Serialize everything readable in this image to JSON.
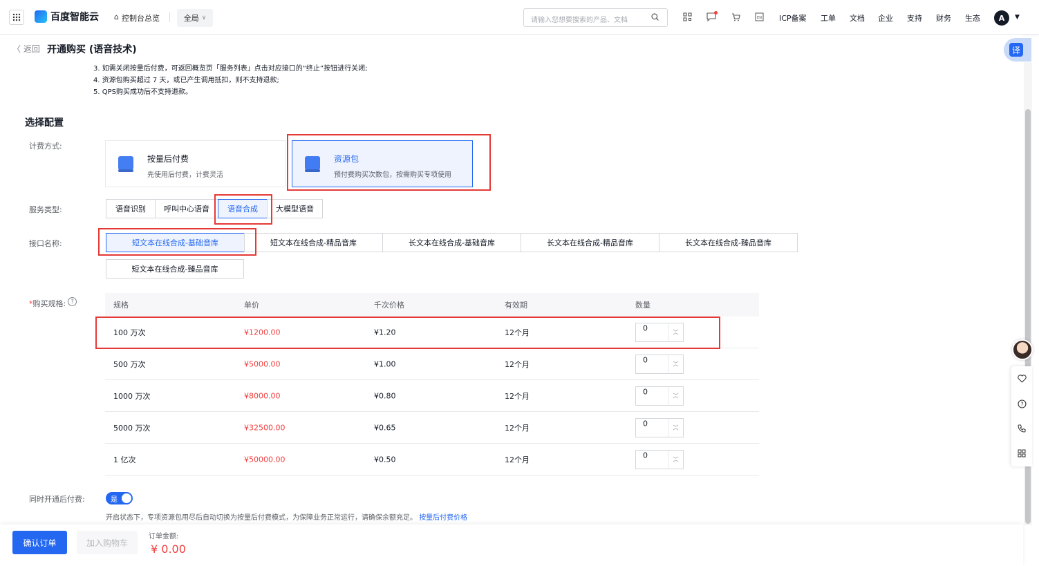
{
  "topbar": {
    "brand": "百度智能云",
    "console": "控制台总览",
    "region": "全局",
    "search_placeholder": "请输入您想要搜索的产品、文档",
    "links": [
      "ICP备案",
      "工单",
      "文档",
      "企业",
      "支持",
      "财务",
      "生态"
    ],
    "avatar_letter": "A"
  },
  "header": {
    "back": "返回",
    "title": "开通购买 (语音技术)",
    "translate": "译"
  },
  "notes": [
    "3. 如需关闭按量后付费，可返回概览页「服务列表」点击对应接口的“终止”按钮进行关闭;",
    "4. 资源包购买超过 7 天，或已产生调用抵扣，则不支持退款;",
    "5. QPS购买成功后不支持退款。"
  ],
  "config": {
    "title": "选择配置",
    "billing_label": "计费方式:",
    "billing": [
      {
        "title": "按量后付费",
        "desc": "先使用后付费，计费灵活"
      },
      {
        "title": "资源包",
        "desc": "预付费购买次数包，按需购买专项使用"
      }
    ],
    "service_label": "服务类型:",
    "services": [
      "语音识别",
      "呼叫中心语音",
      "语音合成",
      "大模型语音"
    ],
    "api_label": "接口名称:",
    "apis": [
      "短文本在线合成-基础音库",
      "短文本在线合成-精品音库",
      "长文本在线合成-基础音库",
      "长文本在线合成-精品音库",
      "长文本在线合成-臻品音库",
      "短文本在线合成-臻品音库"
    ],
    "spec_label": "购买规格:",
    "spec_required": "*",
    "spec_help": "?",
    "spec_headers": [
      "规格",
      "单价",
      "千次价格",
      "有效期",
      "数量"
    ],
    "spec_rows": [
      {
        "spec": "100 万次",
        "price": "¥1200.00",
        "per_k": "¥1.20",
        "validity": "12个月",
        "qty": "0"
      },
      {
        "spec": "500 万次",
        "price": "¥5000.00",
        "per_k": "¥1.00",
        "validity": "12个月",
        "qty": "0"
      },
      {
        "spec": "1000 万次",
        "price": "¥8000.00",
        "per_k": "¥0.80",
        "validity": "12个月",
        "qty": "0"
      },
      {
        "spec": "5000 万次",
        "price": "¥32500.00",
        "per_k": "¥0.65",
        "validity": "12个月",
        "qty": "0"
      },
      {
        "spec": "1 亿次",
        "price": "¥50000.00",
        "per_k": "¥0.50",
        "validity": "12个月",
        "qty": "0"
      }
    ],
    "postpay_label": "同时开通后付费:",
    "postpay_toggle": "是",
    "postpay_note": "开启状态下，专项资源包用尽后自动切换为按量后付费模式，为保障业务正常运行，请确保余额充足。",
    "postpay_link": "按量后付费价格"
  },
  "footer": {
    "confirm": "确认订单",
    "add_cart": "加入购物车",
    "amount_label": "订单金额:",
    "amount": "¥ 0.00"
  }
}
